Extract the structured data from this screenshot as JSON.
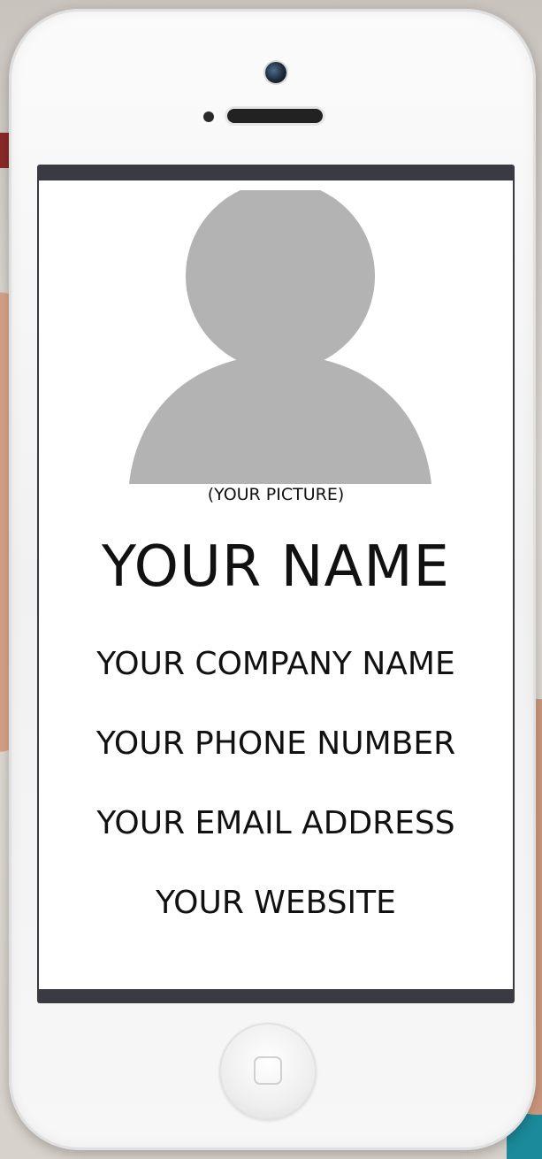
{
  "card": {
    "picture_caption": "(YOUR PICTURE)",
    "name": "YOUR NAME",
    "company": "YOUR COMPANY NAME",
    "phone": "YOUR PHONE NUMBER",
    "email": "YOUR EMAIL ADDRESS",
    "website": "YOUR WEBSITE"
  },
  "icons": {
    "avatar": "person-silhouette-icon",
    "home": "home-button-icon",
    "camera": "front-camera-icon"
  },
  "colors": {
    "avatar_gray": "#b3b3b3",
    "screen_bar": "#3a3a42",
    "text": "#111111"
  }
}
